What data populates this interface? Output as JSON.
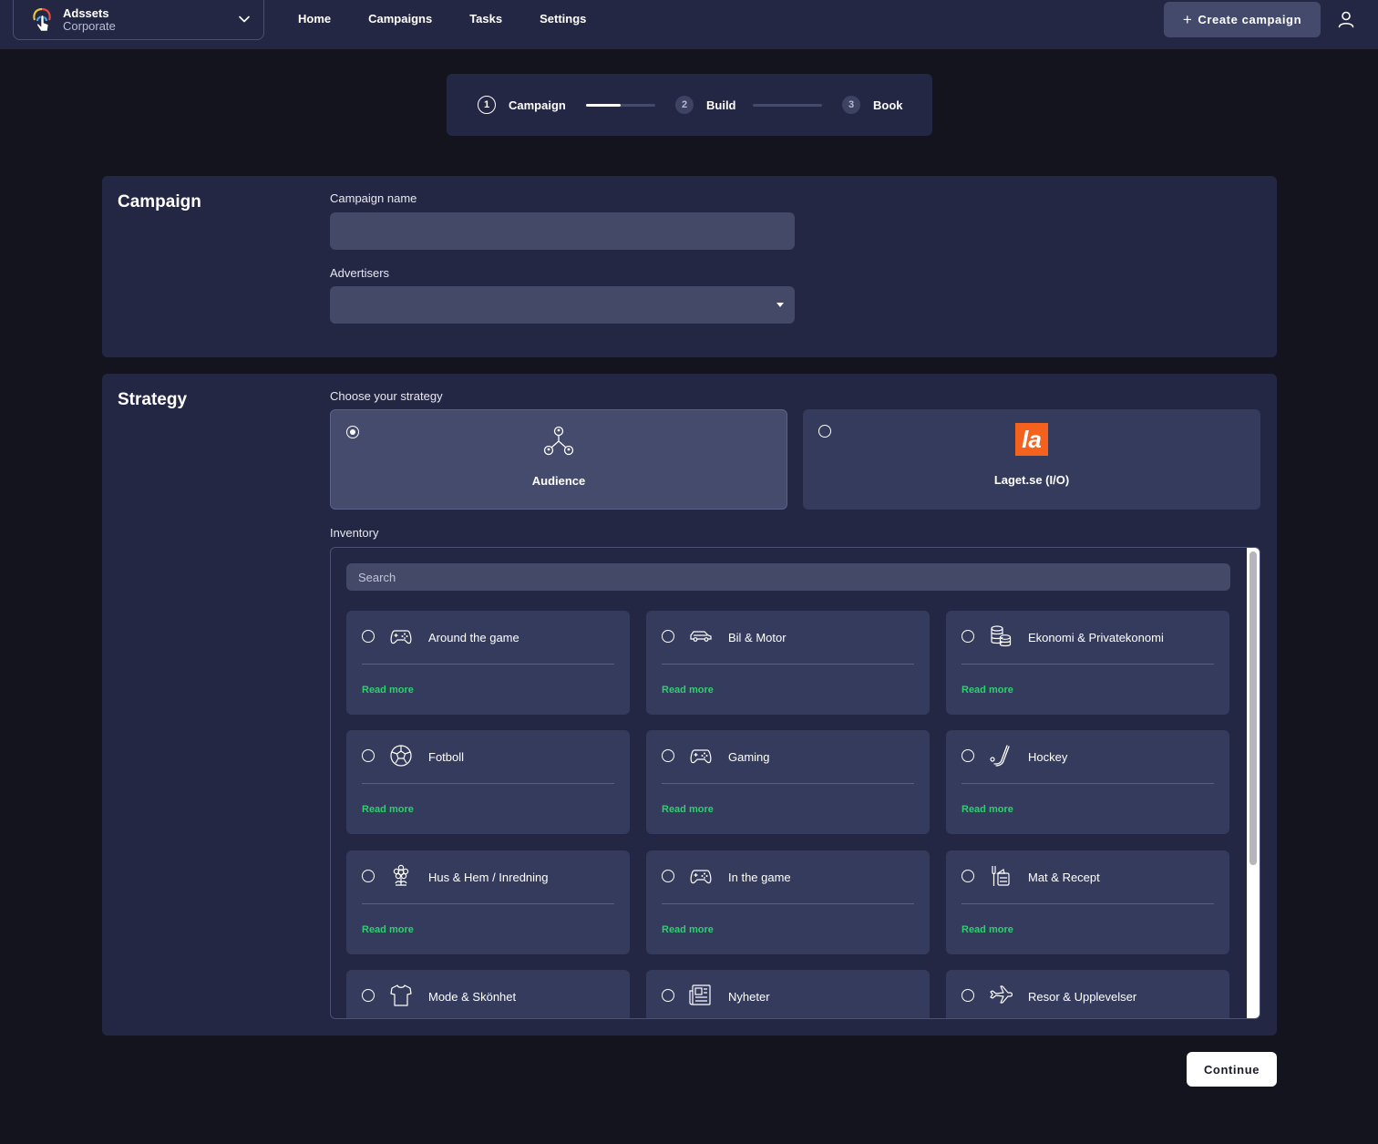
{
  "org": {
    "name": "Adssets",
    "subtitle": "Corporate"
  },
  "nav": {
    "items": [
      "Home",
      "Campaigns",
      "Tasks",
      "Settings"
    ]
  },
  "header": {
    "create_label": "Create campaign"
  },
  "stepper": {
    "steps": [
      {
        "num": "1",
        "label": "Campaign",
        "state": "active"
      },
      {
        "num": "2",
        "label": "Build",
        "state": "inactive"
      },
      {
        "num": "3",
        "label": "Book",
        "state": "inactive"
      }
    ],
    "progress": [
      0.5,
      0
    ]
  },
  "campaign": {
    "title": "Campaign",
    "name_label": "Campaign name",
    "name_value": "",
    "advertisers_label": "Advertisers",
    "advertisers_value": ""
  },
  "strategy": {
    "title": "Strategy",
    "choose_label": "Choose your strategy",
    "options": [
      {
        "label": "Audience",
        "selected": true
      },
      {
        "label": "Laget.se (I/O)",
        "selected": false,
        "logo_text": "la"
      }
    ],
    "inventory_label": "Inventory",
    "search_placeholder": "Search",
    "read_more": "Read more",
    "inventory": [
      {
        "name": "Around the game",
        "icon": "gamepad-icon"
      },
      {
        "name": "Bil & Motor",
        "icon": "car-icon"
      },
      {
        "name": "Ekonomi & Privatekonomi",
        "icon": "coins-icon"
      },
      {
        "name": "Fotboll",
        "icon": "football-icon"
      },
      {
        "name": "Gaming",
        "icon": "gamepad-icon"
      },
      {
        "name": "Hockey",
        "icon": "hockey-stick-icon"
      },
      {
        "name": "Hus & Hem / Inredning",
        "icon": "flower-icon"
      },
      {
        "name": "In the game",
        "icon": "gamepad-icon"
      },
      {
        "name": "Mat & Recept",
        "icon": "food-icon"
      },
      {
        "name": "Mode & Skönhet",
        "icon": "shirt-icon"
      },
      {
        "name": "Nyheter",
        "icon": "newspaper-icon"
      },
      {
        "name": "Resor & Upplevelser",
        "icon": "airplane-icon"
      }
    ]
  },
  "footer": {
    "continue_label": "Continue"
  },
  "colors": {
    "accent_green": "#2fcf6f",
    "laget_orange": "#f5621e",
    "panel": "#242743",
    "background": "#14141f"
  }
}
